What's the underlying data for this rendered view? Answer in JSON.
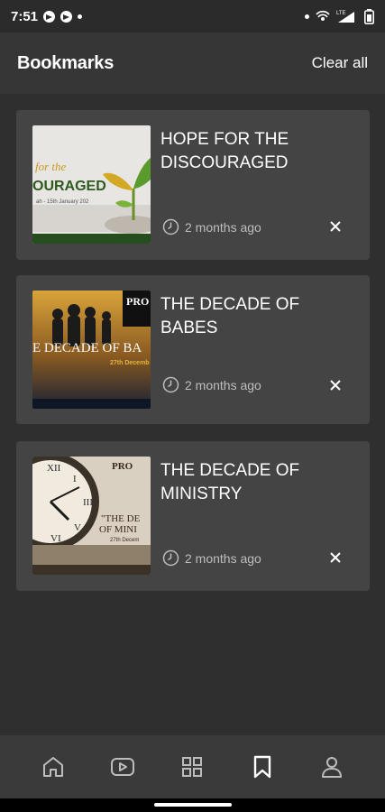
{
  "status_bar": {
    "time": "7:51",
    "icons": [
      "telegram-icon",
      "telegram-icon",
      "dot-icon",
      "dot-icon",
      "hotspot-icon",
      "signal-icon",
      "battery-icon"
    ],
    "network_label": "LTE"
  },
  "header": {
    "title": "Bookmarks",
    "clear_all_label": "Clear all"
  },
  "bookmarks": [
    {
      "title": "HOPE FOR THE DISCOURAGED",
      "time": "2 months ago",
      "thumb_text": [
        "for the",
        "OURAGED",
        "ah - 15th January 202"
      ],
      "thumb_icon": "seedling-image"
    },
    {
      "title": "THE DECADE OF BABES",
      "time": "2 months ago",
      "thumb_text": [
        "PRO",
        "E DECADE OF BA",
        "27th Decemb"
      ],
      "thumb_icon": "silhouettes-image"
    },
    {
      "title": "THE DECADE OF MINISTRY",
      "time": "2 months ago",
      "thumb_text": [
        "PRO",
        "\"THE DE",
        "OF MINI",
        "27th Decem"
      ],
      "thumb_icon": "clock-image"
    }
  ],
  "nav": {
    "items": [
      "home-icon",
      "video-icon",
      "grid-icon",
      "bookmark-icon",
      "profile-icon"
    ],
    "active": "bookmark-icon"
  },
  "colors": {
    "background": "#2f2f2f",
    "card": "#444444",
    "header": "#363636",
    "text": "#ffffff",
    "muted": "#bdbdbd"
  }
}
